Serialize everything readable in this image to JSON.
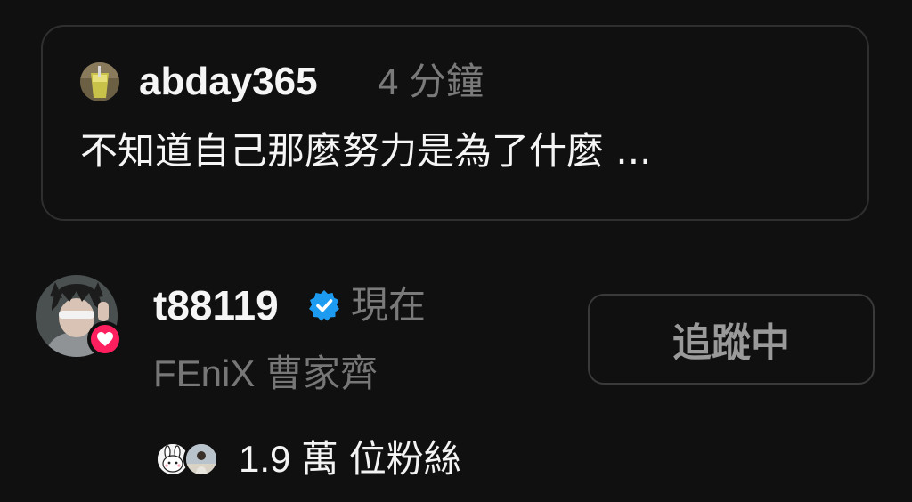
{
  "quoted_post": {
    "username": "abday365",
    "time": "4 分鐘",
    "text": "不知道自己那麼努力是為了什麼 ..."
  },
  "user": {
    "username": "t88119",
    "verified": true,
    "time": "現在",
    "display_name": "FEniX 曹家齊",
    "follow_button_label": "追蹤中",
    "followers_label": "1.9 萬 位粉絲"
  },
  "icons": {
    "heart": "heart-icon",
    "verified": "verified-badge-icon"
  },
  "colors": {
    "background": "#101010",
    "heart_badge": "#ff1f5f",
    "verified": "#1d9bf0",
    "muted_text": "#7a7a7a"
  }
}
